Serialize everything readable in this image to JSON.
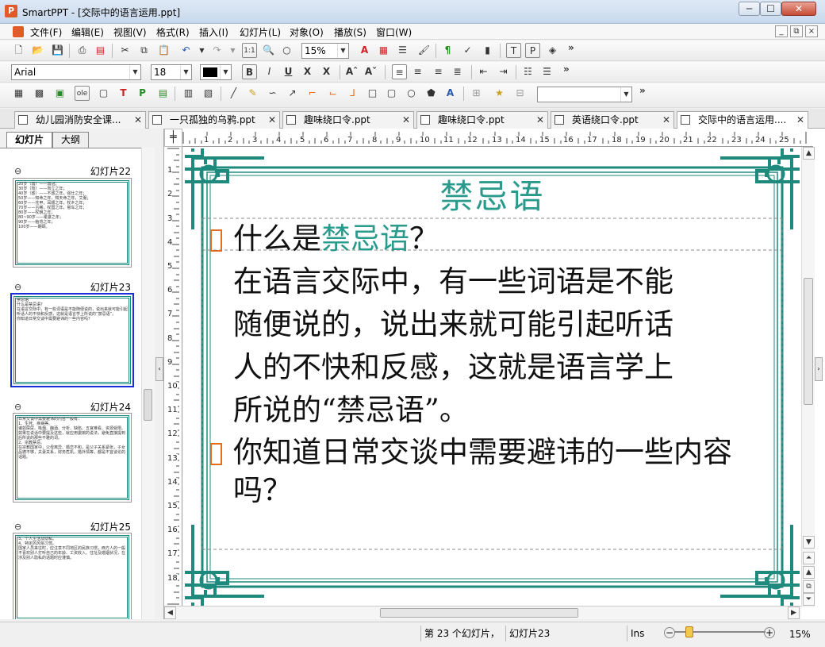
{
  "window": {
    "app_icon": "P",
    "title": "SmartPPT - [交际中的语言运用.ppt]",
    "btn_min": "─",
    "btn_max": "☐",
    "btn_close": "✕"
  },
  "menu": [
    "文件(F)",
    "编辑(E)",
    "视图(V)",
    "格式(R)",
    "插入(I)",
    "幻灯片(L)",
    "对象(O)",
    "播放(S)",
    "窗口(W)"
  ],
  "mdi_buttons": [
    "_",
    "⧉",
    "×"
  ],
  "toolbar1": {
    "zoom_value": "15%",
    "more": "»"
  },
  "toolbar2": {
    "font_name": "Arial",
    "font_size": "18",
    "more": "»"
  },
  "toolbar3": {
    "shape_combo": "",
    "more": "»"
  },
  "tabs": [
    {
      "label": "幼儿园消防安全课..."
    },
    {
      "label": "一只孤独的乌鸦.ppt"
    },
    {
      "label": "趣味绕口令.ppt"
    },
    {
      "label": "趣味绕口令.ppt"
    },
    {
      "label": "英语绕口令.ppt"
    },
    {
      "label": "交际中的语言运用...."
    }
  ],
  "tab_close": "✕",
  "panel": {
    "tab_slides": "幻灯片",
    "tab_outline": "大纲",
    "thumbs": [
      {
        "label": "幻灯片22",
        "text": "20岁（弱）——弱冠；\n30岁（而）——而立之年；\n40岁（惑）——不惑之年，强仕之年；\n50岁——知命之年，知天命之年，艾服；\n60岁——花甲，耳顺之年，杖乡之年；\n70岁——古稀，杖国之年，悬车之年；\n80岁——杖朝之年；\n80~90岁——耄耋之年；\n90岁——鲐背之年；\n100岁——期颐。"
      },
      {
        "label": "幻灯片23",
        "text": "禁忌语\n什么是禁忌语？\n在语言交际中，有一些词语是不能随便说的，说出来就可能引起听话人的不快和反感，这就是语言学上所说的“禁忌语”。\n你知道日常交谈中需要避讳的一些内容吗？"
      },
      {
        "label": "幻灯片24",
        "text": "日常交谈中需要避讳的内容一般有：\n1、生死、疾病等。\n诸如屎尿、吸烟、酗酒、分析、缺陷、五官难看、资源受限。如果在说话中要提及这些，就应用委婉的说法，避免直接提到后所说的那些不雅的词。\n2、宗教禁忌。\n在宗教国家中，父母离异、婚恋不和，是父子关系紧张，子女品德不够，夫妻关系，财务危机，婚外情等，都是不宜谈论的话题。"
      },
      {
        "label": "幻灯片25",
        "text": "3、个人生活及隐私。\n4、特定的风俗习惯。\n国家人员来往时，应注意不同地区的民族习惯，西方人的一般不喜欢别人打听自己的年龄、工资收入、住址及婚姻状况，在涉及别人隐私的话题时应谨慎。"
      }
    ]
  },
  "ruler": {
    "corner": "╪",
    "h": [
      "1",
      "2",
      "3",
      "4",
      "5",
      "6",
      "7",
      "8",
      "9",
      "10",
      "11",
      "12",
      "13",
      "14",
      "15",
      "16",
      "17",
      "18",
      "19",
      "20",
      "21",
      "22",
      "23",
      "24",
      "25"
    ],
    "v": [
      "1",
      "2",
      "3",
      "4",
      "5",
      "6",
      "7",
      "8",
      "9",
      "10",
      "11",
      "12",
      "13",
      "14",
      "15",
      "16",
      "17",
      "18"
    ]
  },
  "slide": {
    "title": "禁忌语",
    "q1_prefix": "什么是",
    "q1_term": "禁忌语",
    "q1_suffix": "？",
    "body_lines": [
      "在语言交际中，有一些词语是不能",
      "随便说的，说出来就可能引起听话",
      "人的不快和反感，这就是语言学上",
      "所说的“禁忌语”。"
    ],
    "q2_lines": [
      "你知道日常交谈中需要避讳的一些内容",
      "吗？"
    ]
  },
  "status": {
    "slide_count": "第 23 个幻灯片，",
    "current": "幻灯片23",
    "mode": "Ins",
    "zoom": "15%",
    "minus": "−",
    "plus": "+"
  },
  "colors": {
    "accent": "#2a9a8c",
    "bullet": "#e07020",
    "selection": "#1a2ed8"
  },
  "icons": [
    "app-icon",
    "new-icon",
    "open-icon",
    "save-icon",
    "print-icon",
    "pdf-icon",
    "cut-icon",
    "copy-icon",
    "paste-icon",
    "undo-icon",
    "redo-icon",
    "zoom-icon",
    "find-icon",
    "bold-icon",
    "italic-icon",
    "underline-icon",
    "align-left-icon",
    "align-center-icon",
    "align-right-icon",
    "justify-icon",
    "star-icon",
    "line-icon",
    "rect-icon",
    "ellipse-icon"
  ]
}
